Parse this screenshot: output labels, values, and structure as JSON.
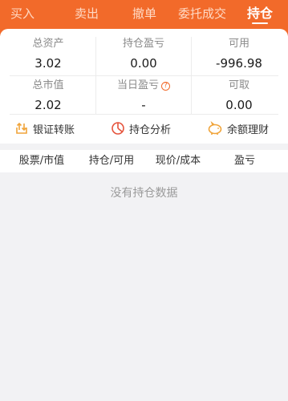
{
  "tabs": [
    {
      "label": "买入",
      "active": false
    },
    {
      "label": "卖出",
      "active": false
    },
    {
      "label": "撤单",
      "active": false
    },
    {
      "label": "委托成交",
      "active": false
    },
    {
      "label": "持仓",
      "active": true
    }
  ],
  "summary": {
    "total_assets": {
      "label": "总资产",
      "value": "3.02"
    },
    "position_pnl": {
      "label": "持仓盈亏",
      "value": "0.00"
    },
    "available": {
      "label": "可用",
      "value": "-996.98"
    },
    "market_value": {
      "label": "总市值",
      "value": "2.02"
    },
    "daily_pnl": {
      "label": "当日盈亏",
      "value": "-"
    },
    "withdrawable": {
      "label": "可取",
      "value": "0.00"
    }
  },
  "actions": [
    {
      "label": "银证转账",
      "icon": "transfer-icon"
    },
    {
      "label": "持仓分析",
      "icon": "pie-chart-icon"
    },
    {
      "label": "余额理财",
      "icon": "piggy-bank-icon"
    }
  ],
  "table": {
    "columns": [
      "股票/市值",
      "持仓/可用",
      "现价/成本",
      "盈亏"
    ],
    "empty_text": "没有持仓数据"
  },
  "colors": {
    "accent": "#f26a2a",
    "background": "#f2f2f4",
    "card": "#ffffff"
  }
}
